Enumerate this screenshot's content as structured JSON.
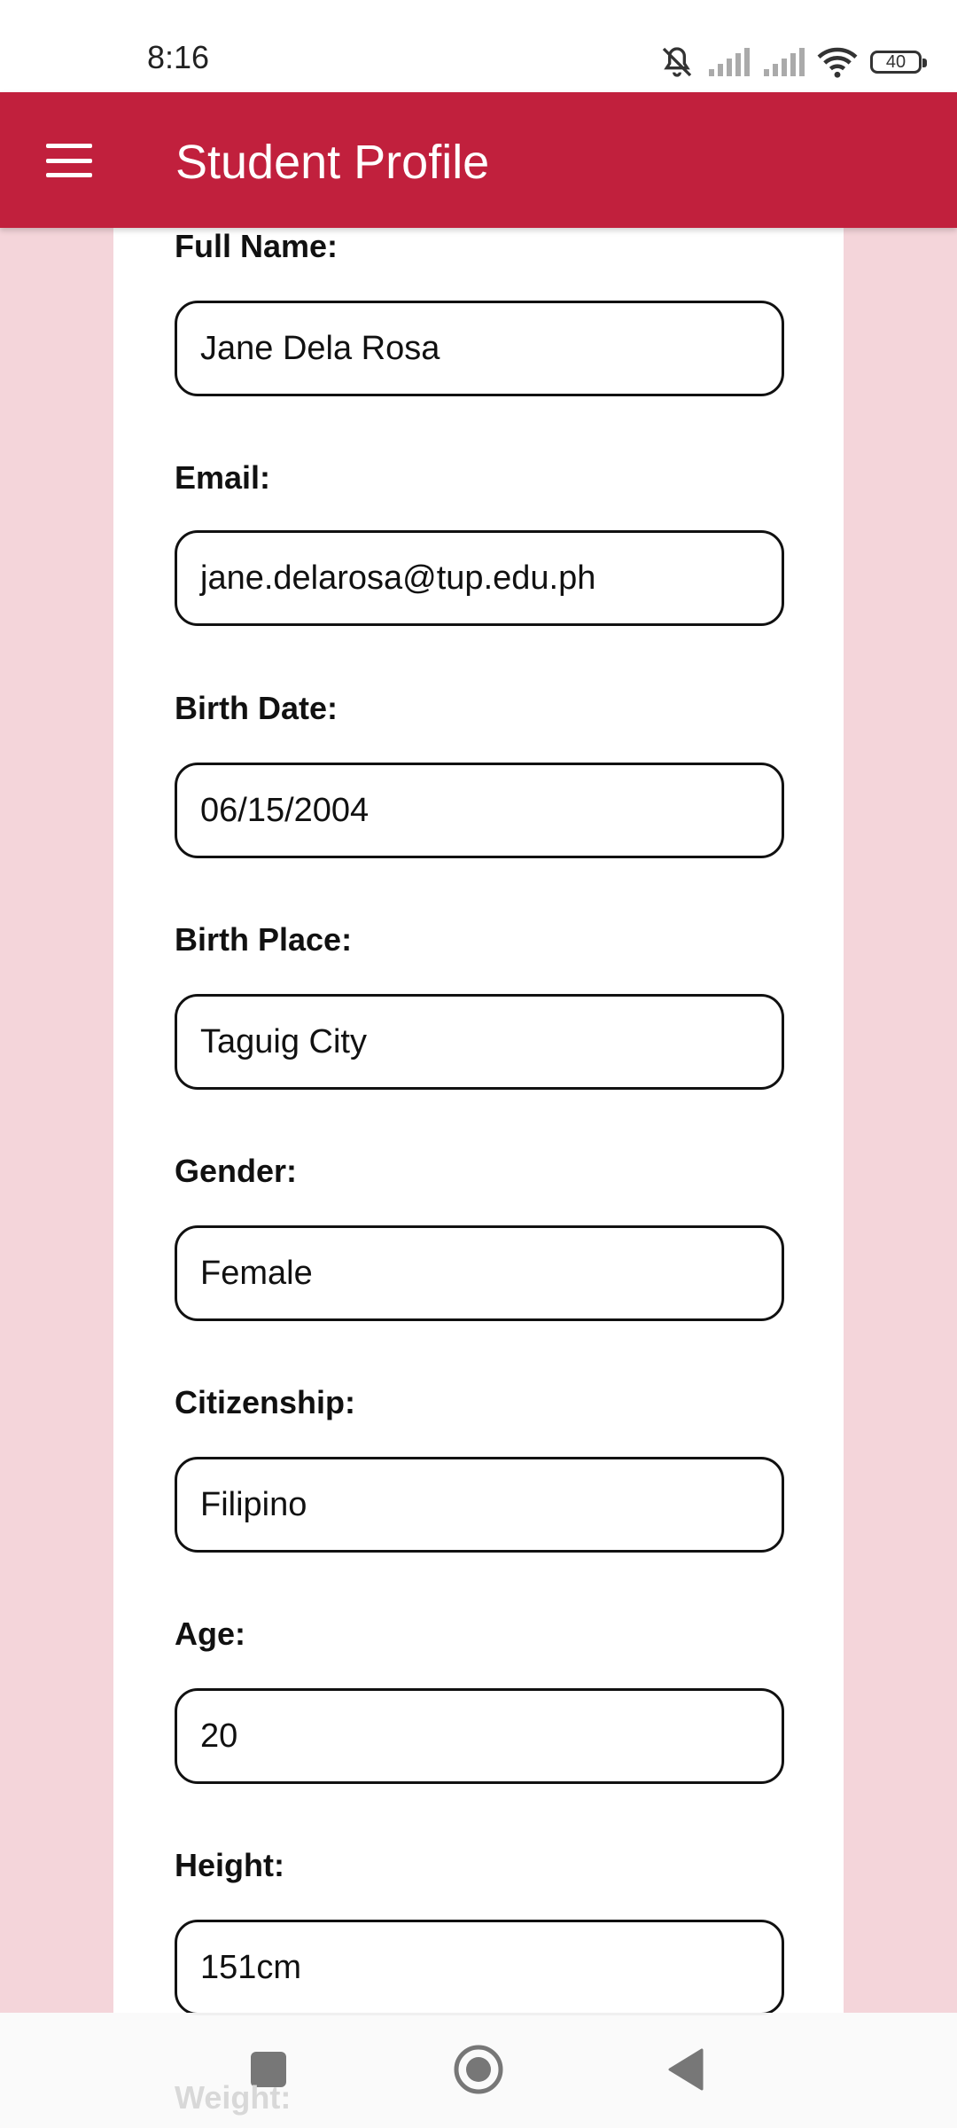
{
  "status": {
    "time": "8:16",
    "battery": "40",
    "icons": [
      "bell-off-icon",
      "signal-icon",
      "signal-icon",
      "wifi-icon",
      "battery-icon"
    ]
  },
  "app_bar": {
    "title": "Student Profile",
    "menu_icon": "menu-icon"
  },
  "colors": {
    "primary": "#c1203d",
    "background": "#f4d5da",
    "card": "#ffffff"
  },
  "form": {
    "fields": [
      {
        "label": "Full Name:",
        "value": "Jane Dela Rosa"
      },
      {
        "label": "Email:",
        "value": "jane.delarosa@tup.edu.ph"
      },
      {
        "label": "Birth Date:",
        "value": "06/15/2004"
      },
      {
        "label": "Birth Place:",
        "value": "Taguig City"
      },
      {
        "label": "Gender:",
        "value": "Female"
      },
      {
        "label": "Citizenship:",
        "value": "Filipino"
      },
      {
        "label": "Age:",
        "value": "20"
      },
      {
        "label": "Height:",
        "value": "151cm"
      }
    ],
    "partial_label": "Weight:"
  },
  "nav": {
    "recents_icon": "square-icon",
    "home_icon": "circle-icon",
    "back_icon": "triangle-back-icon"
  }
}
